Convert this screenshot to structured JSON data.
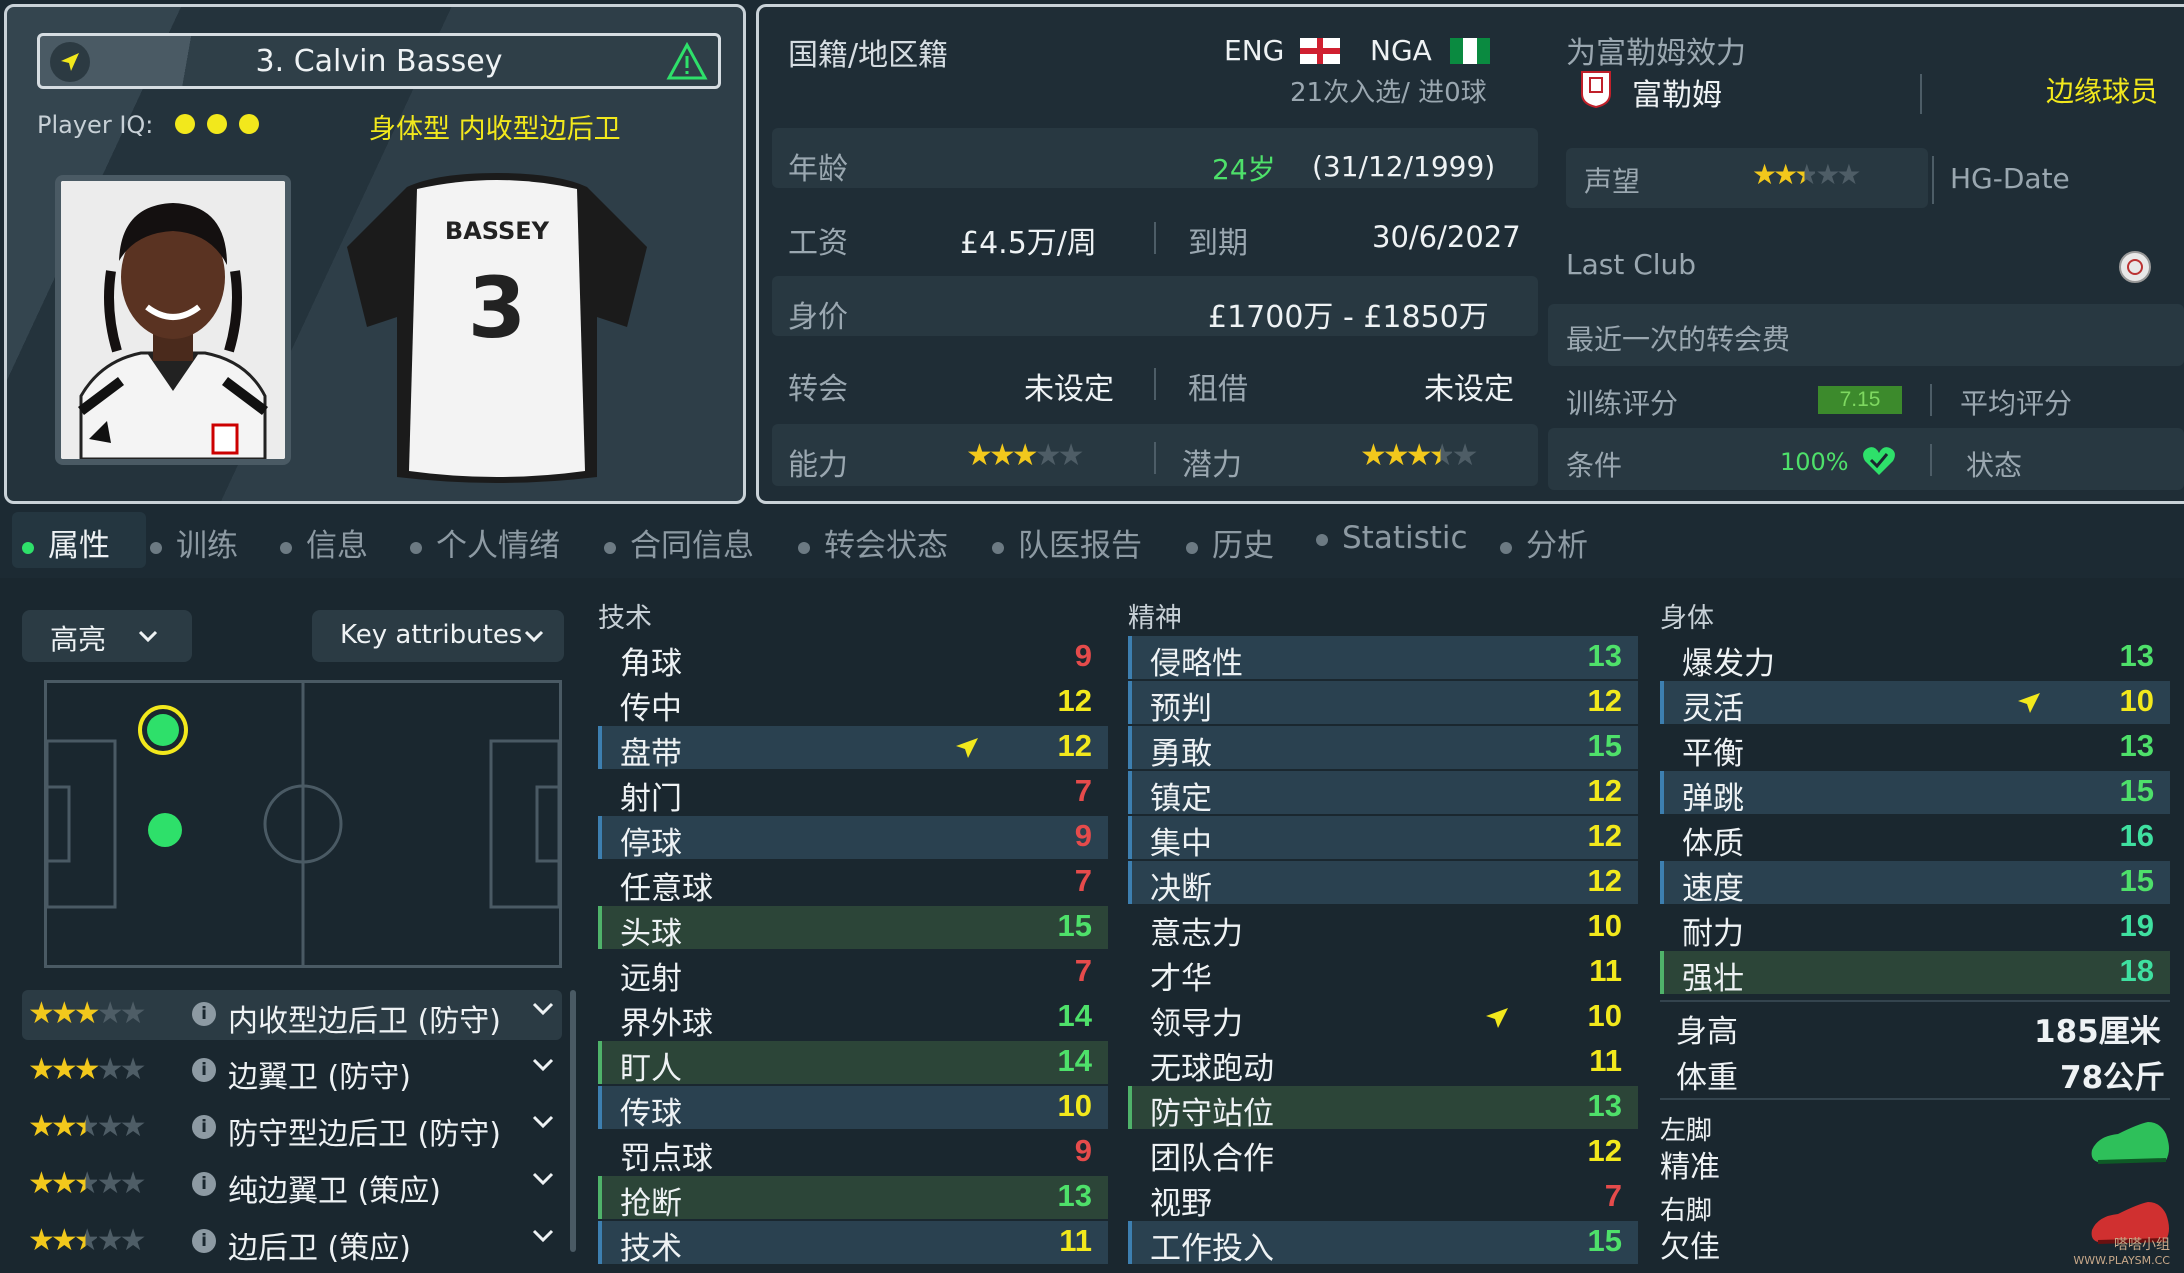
{
  "player": {
    "name": "3. Calvin Bassey",
    "iq_label": "Player IQ:",
    "role_desc": "身体型 内收型边后卫",
    "shirt_name": "BASSEY",
    "shirt_number": "3"
  },
  "info": {
    "nationality_label": "国籍/地区籍",
    "nat1": "ENG",
    "nat2": "NGA",
    "caps": "21次入选/ 进0球",
    "age_label": "年龄",
    "age": "24岁",
    "dob": "(31/12/1999)",
    "wage_label": "工资",
    "wage": "£4.5万/周",
    "expiry_label": "到期",
    "expiry": "30/6/2027",
    "value_label": "身价",
    "value": "£1700万 - £1850万",
    "transfer_label": "转会",
    "transfer": "未设定",
    "loan_label": "租借",
    "loan": "未设定",
    "ability_label": "能力",
    "potential_label": "潜力",
    "ability_stars": 3,
    "potential_stars": 3.5
  },
  "club": {
    "plays_for_label": "为富勒姆效力",
    "club_name": "富勒姆",
    "squad_status": "边缘球员",
    "reputation_label": "声望",
    "reputation_stars": 2.5,
    "hg_label": "HG-Date",
    "last_club_label": "Last Club",
    "last_transfer_label": "最近一次的转会费",
    "training_label": "训练评分",
    "training_value": "7.15",
    "avg_label": "平均评分",
    "condition_label": "条件",
    "condition_value": "100%",
    "status_label": "状态"
  },
  "tabs": [
    "属性",
    "训练",
    "信息",
    "个人情绪",
    "合同信息",
    "转会状态",
    "队医报告",
    "历史",
    "Statistic",
    "分析"
  ],
  "filters": {
    "highlight": "高亮",
    "key_attributes": "Key attributes"
  },
  "roles": [
    {
      "name": "内收型边后卫 (防守)",
      "stars": 3
    },
    {
      "name": "边翼卫 (防守)",
      "stars": 3
    },
    {
      "name": "防守型边后卫 (防守)",
      "stars": 2.5
    },
    {
      "name": "纯边翼卫 (策应)",
      "stars": 2.5
    },
    {
      "name": "边后卫 (策应)",
      "stars": 2.5
    }
  ],
  "technical": {
    "title": "技术",
    "items": [
      {
        "name": "角球",
        "value": "9"
      },
      {
        "name": "传中",
        "value": "12"
      },
      {
        "name": "盘带",
        "value": "12"
      },
      {
        "name": "射门",
        "value": "7"
      },
      {
        "name": "停球",
        "value": "9"
      },
      {
        "name": "任意球",
        "value": "7"
      },
      {
        "name": "头球",
        "value": "15"
      },
      {
        "name": "远射",
        "value": "7"
      },
      {
        "name": "界外球",
        "value": "14"
      },
      {
        "name": "盯人",
        "value": "14"
      },
      {
        "name": "传球",
        "value": "10"
      },
      {
        "name": "罚点球",
        "value": "9"
      },
      {
        "name": "抢断",
        "value": "13"
      },
      {
        "name": "技术",
        "value": "11"
      }
    ]
  },
  "mental": {
    "title": "精神",
    "items": [
      {
        "name": "侵略性",
        "value": "13"
      },
      {
        "name": "预判",
        "value": "12"
      },
      {
        "name": "勇敢",
        "value": "15"
      },
      {
        "name": "镇定",
        "value": "12"
      },
      {
        "name": "集中",
        "value": "12"
      },
      {
        "name": "决断",
        "value": "12"
      },
      {
        "name": "意志力",
        "value": "10"
      },
      {
        "name": "才华",
        "value": "11"
      },
      {
        "name": "领导力",
        "value": "10"
      },
      {
        "name": "无球跑动",
        "value": "11"
      },
      {
        "name": "防守站位",
        "value": "13"
      },
      {
        "name": "团队合作",
        "value": "12"
      },
      {
        "name": "视野",
        "value": "7"
      },
      {
        "name": "工作投入",
        "value": "15"
      }
    ]
  },
  "physical": {
    "title": "身体",
    "items": [
      {
        "name": "爆发力",
        "value": "13"
      },
      {
        "name": "灵活",
        "value": "10"
      },
      {
        "name": "平衡",
        "value": "13"
      },
      {
        "name": "弹跳",
        "value": "15"
      },
      {
        "name": "体质",
        "value": "16"
      },
      {
        "name": "速度",
        "value": "15"
      },
      {
        "name": "耐力",
        "value": "19"
      },
      {
        "name": "强壮",
        "value": "18"
      }
    ],
    "height_label": "身高",
    "height": "185厘米",
    "weight_label": "体重",
    "weight": "78公斤",
    "left_foot_label": "左脚",
    "left_foot": "精准",
    "right_foot_label": "右脚",
    "right_foot": "欠佳"
  },
  "watermark": {
    "line1": "嗒嗒小组",
    "line2": "WWW.PLAYSM.CC"
  },
  "colors": {
    "accent_green": "#2ee06a",
    "star_gold": "#f2c81c",
    "highlight_yellow": "#f2e81c"
  }
}
